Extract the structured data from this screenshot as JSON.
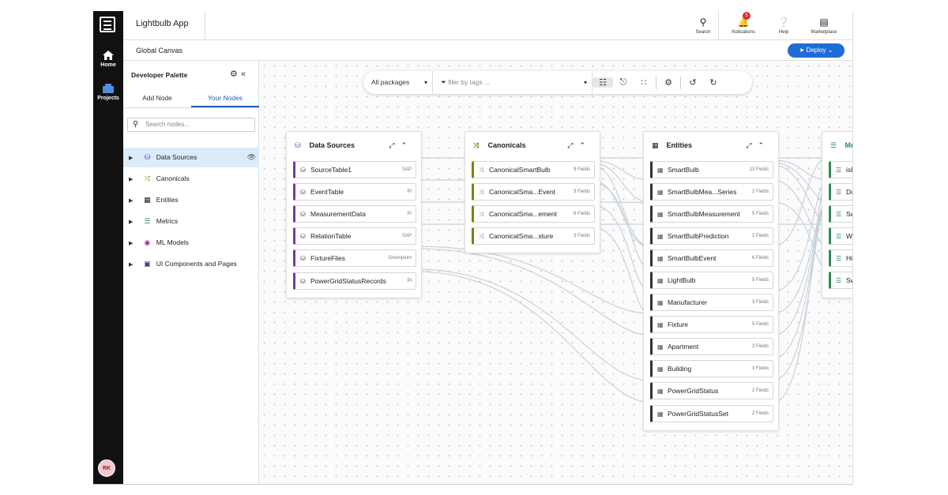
{
  "app": {
    "title": "Lightbulb App"
  },
  "rail": {
    "items": [
      {
        "label": "Home",
        "icon": "home-icon"
      },
      {
        "label": "Projects",
        "icon": "projects-icon"
      }
    ],
    "avatar": "RK"
  },
  "topbar": {
    "actions": [
      {
        "label": "Search",
        "icon": "search-icon"
      },
      {
        "label": "Notications",
        "icon": "bell-icon",
        "badge": "5"
      },
      {
        "label": "Help",
        "icon": "help-icon"
      },
      {
        "label": "Marketplace",
        "icon": "store-icon"
      }
    ]
  },
  "subbar": {
    "breadcrumb": "Global Canvas",
    "deploy_label": "Deploy"
  },
  "palette": {
    "title": "Developer Palette",
    "tabs": [
      "Add Node",
      "Your Nodes"
    ],
    "active_tab": "Your Nodes",
    "search_placeholder": "Search nodes...",
    "items": [
      {
        "label": "Data Sources",
        "icon": "database-icon",
        "selected": true
      },
      {
        "label": "Canonicals",
        "icon": "shuffle-icon"
      },
      {
        "label": "Entities",
        "icon": "table-icon"
      },
      {
        "label": "Metrics",
        "icon": "waveform-icon"
      },
      {
        "label": "ML Models",
        "icon": "brain-icon"
      },
      {
        "label": "UI Components and Pages",
        "icon": "ui-pages-icon"
      }
    ]
  },
  "toolbar": {
    "packages": "All packages",
    "filter_placeholder": "filer by tags ..."
  },
  "cards": {
    "data_sources": {
      "title": "Data Sources",
      "nodes": [
        {
          "name": "SourceTable1",
          "meta": "SAP"
        },
        {
          "name": "EventTable",
          "meta": "Pi"
        },
        {
          "name": "MeasurementData",
          "meta": "Pi"
        },
        {
          "name": "RelationTable",
          "meta": "SAP"
        },
        {
          "name": "FixtureFiles",
          "meta": "Greenplum"
        },
        {
          "name": "PowerGridStatusRecords",
          "meta": "Pi"
        }
      ]
    },
    "canonicals": {
      "title": "Canonicals",
      "nodes": [
        {
          "name": "CanonicalSmartBulb",
          "meta": "9 Fields"
        },
        {
          "name": "CanonicalSma...Event",
          "meta": "3 Fields"
        },
        {
          "name": "CanonicalSma...ement",
          "meta": "6 Fields"
        },
        {
          "name": "CanonicalSma...xture",
          "meta": "3 Fields"
        }
      ]
    },
    "entities": {
      "title": "Entities",
      "nodes": [
        {
          "name": "SmartBulb",
          "meta": "13 Fields"
        },
        {
          "name": "SmartBulbMea...Series",
          "meta": "2 Fields"
        },
        {
          "name": "SmartBulbMeasurement",
          "meta": "5 Fields"
        },
        {
          "name": "SmartBulbPrediction",
          "meta": "2 Fields"
        },
        {
          "name": "SmartBulbEvent",
          "meta": "6 Fields"
        },
        {
          "name": "LightBulb",
          "meta": "5 Fields"
        },
        {
          "name": "Manufacturer",
          "meta": "3 Fields"
        },
        {
          "name": "Fixture",
          "meta": "5 Fields"
        },
        {
          "name": "Apartment",
          "meta": "3 Fields"
        },
        {
          "name": "Building",
          "meta": "3 Fields"
        },
        {
          "name": "PowerGridStatus",
          "meta": "2 Fields"
        },
        {
          "name": "PowerGridStatusSet",
          "meta": "2 Fields"
        }
      ]
    },
    "metrics": {
      "title": "Me",
      "nodes": [
        {
          "name": "isD"
        },
        {
          "name": "Du"
        },
        {
          "name": "Sw"
        },
        {
          "name": "Wi"
        },
        {
          "name": "Hi"
        },
        {
          "name": "Sw"
        }
      ]
    }
  },
  "colors": {
    "accent": "#1e6dd5",
    "source_bar": "#6b3fa0",
    "canonical_bar": "#6a8a1c",
    "metric_bar": "#2e8b57",
    "badge": "#d32f2f"
  }
}
